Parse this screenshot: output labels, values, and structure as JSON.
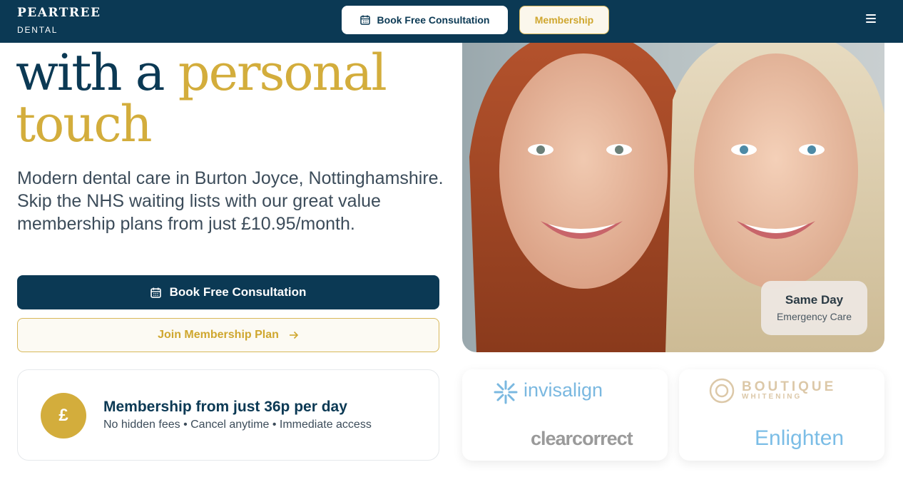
{
  "header": {
    "logo_main": "PEARTREE",
    "logo_sub": "DENTAL",
    "book_button": "Book Free Consultation",
    "membership_button": "Membership"
  },
  "hero": {
    "title_line1_a": "with a ",
    "title_line1_b": "personal",
    "title_line2": "touch",
    "description": "Modern dental care in Burton Joyce, Nottinghamshire. Skip the NHS waiting lists with our great value membership plans from just £10.95/month.",
    "primary_button": "Book Free Consultation",
    "secondary_button": "Join Membership Plan"
  },
  "membership_card": {
    "icon_symbol": "£",
    "title": "Membership from just 36p per day",
    "subtitle": "No hidden fees • Cancel anytime • Immediate access"
  },
  "emergency_badge": {
    "title": "Same Day",
    "subtitle": "Emergency Care"
  },
  "brands": {
    "invisalign": "invisalign",
    "clearcorrect": "clearcorrect",
    "boutique": "BOUTIQUE",
    "boutique_sub": "WHITENING",
    "enlighten": "Enlighten"
  },
  "colors": {
    "navy": "#0b3954",
    "gold": "#d3ad3c"
  },
  "icons": {
    "calendar": "calendar-icon",
    "arrow": "arrow-right-icon",
    "menu": "hamburger-icon"
  }
}
